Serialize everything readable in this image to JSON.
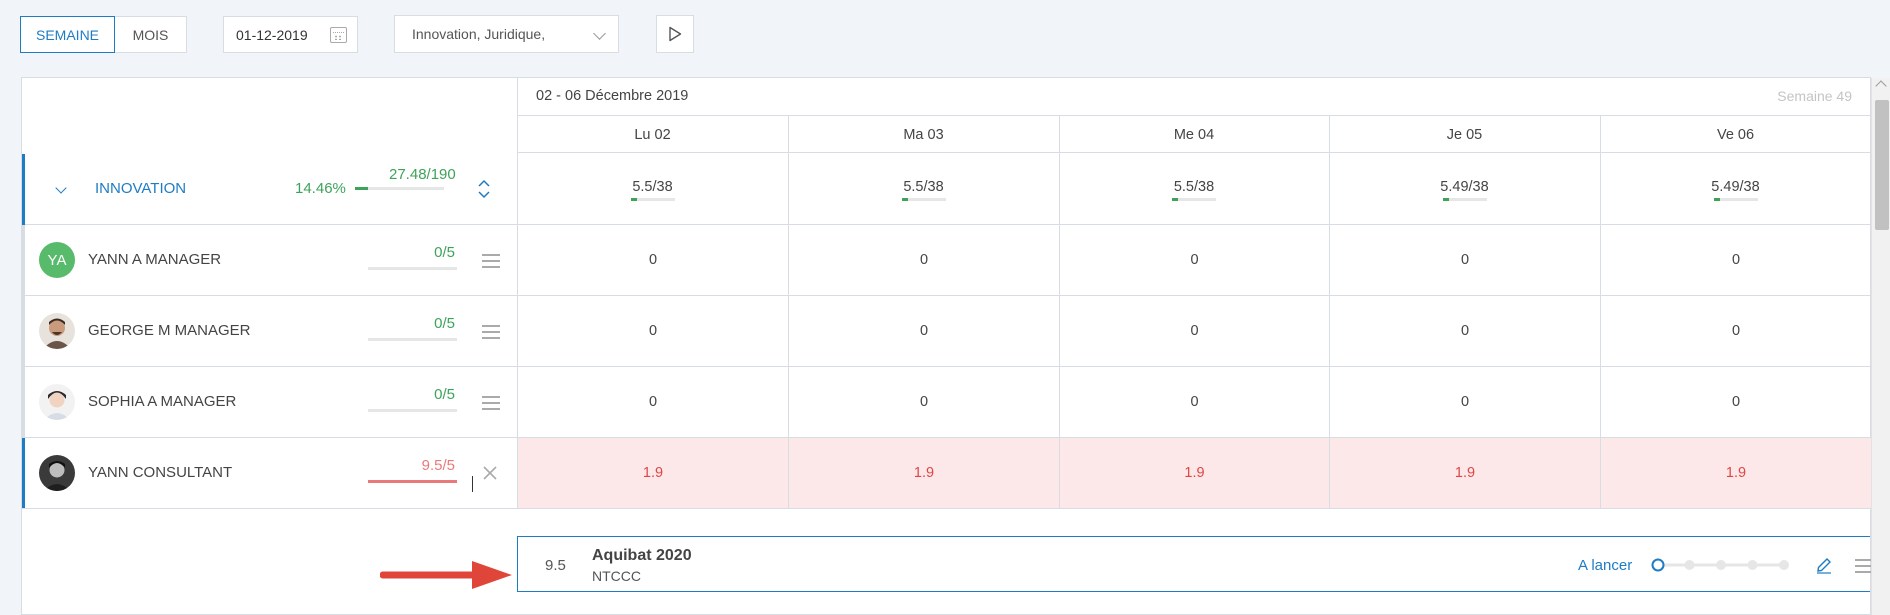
{
  "toolbar": {
    "view_week": "SEMAINE",
    "view_month": "MOIS",
    "date_value": "01-12-2019",
    "filter_value": "Innovation, Juridique,"
  },
  "calendar": {
    "period_label": "02 - 06 Décembre 2019",
    "week_label": "Semaine 49",
    "days": [
      "Lu 02",
      "Ma 03",
      "Me 04",
      "Je 05",
      "Ve 06"
    ]
  },
  "group": {
    "name": "INNOVATION",
    "percent": "14.46%",
    "ratio": "27.48/190",
    "progress": 0.1446,
    "day_values": [
      "5.5/38",
      "5.5/38",
      "5.5/38",
      "5.49/38",
      "5.49/38"
    ],
    "day_progress": [
      0.145,
      0.145,
      0.145,
      0.144,
      0.144
    ]
  },
  "people": [
    {
      "initials": "YA",
      "name": "YANN A MANAGER",
      "ratio": "0/5",
      "progress": 0,
      "over": false,
      "days": [
        "0",
        "0",
        "0",
        "0",
        "0"
      ]
    },
    {
      "initials": "",
      "name": "GEORGE M MANAGER",
      "ratio": "0/5",
      "progress": 0,
      "over": false,
      "days": [
        "0",
        "0",
        "0",
        "0",
        "0"
      ]
    },
    {
      "initials": "",
      "name": "SOPHIA A MANAGER",
      "ratio": "0/5",
      "progress": 0,
      "over": false,
      "days": [
        "0",
        "0",
        "0",
        "0",
        "0"
      ]
    },
    {
      "initials": "",
      "name": "YANN CONSULTANT",
      "ratio": "9.5/5",
      "progress": 1,
      "over": true,
      "days": [
        "1.9",
        "1.9",
        "1.9",
        "1.9",
        "1.9"
      ]
    }
  ],
  "task": {
    "value": "9.5",
    "name": "Aquibat 2020",
    "code": "NTCCC",
    "status": "A lancer",
    "steps_total": 5,
    "steps_done": 1
  },
  "colors": {
    "accent": "#1e7cc4",
    "ok": "#3ea35a",
    "over": "#e04646",
    "over_bg": "#fce8e8",
    "arrow": "#e0453a"
  }
}
